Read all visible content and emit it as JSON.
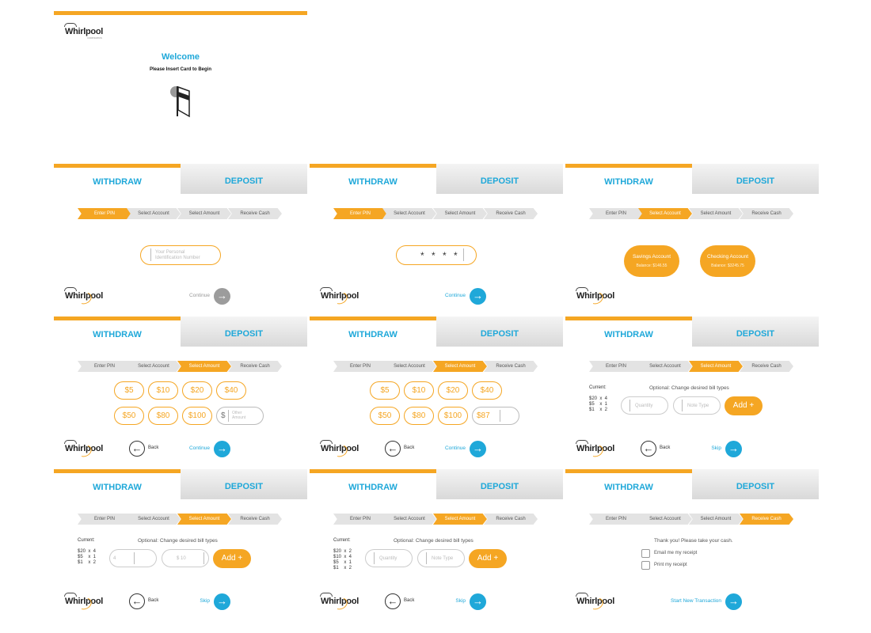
{
  "logo": {
    "text": "Whirlpool",
    "sub": "CORPORATION"
  },
  "tabs": {
    "withdraw": "WITHDRAW",
    "deposit": "DEPOSIT"
  },
  "steps": [
    "Enter PIN",
    "Select Account",
    "Select Amount",
    "Receive Cash"
  ],
  "welcome": {
    "title": "Welcome",
    "subtitle": "Please Insert Card to Begin"
  },
  "pin": {
    "placeholder_line1": "Your Personal",
    "placeholder_line2": "Identification Number",
    "masked": "* * * *"
  },
  "accounts": [
    {
      "name": "Savings Account",
      "balance": "Balance: $146.55"
    },
    {
      "name": "Checking Account",
      "balance": "Balance: $3245.75"
    }
  ],
  "amounts": [
    "$5",
    "$10",
    "$20",
    "$40",
    "$50",
    "$80",
    "$100"
  ],
  "other_amount": {
    "symbol": "$",
    "label_line1": "Other",
    "label_line2": "Amount",
    "entered": "$87"
  },
  "bills": {
    "current_label": "Current:",
    "optional_label": "Optional: Change desired bill types",
    "set_a": [
      "$20  x  4",
      "$5    x  1",
      "$1    x  2"
    ],
    "set_b": [
      "$20  x  2",
      "$10  x  4",
      "$5    x  1",
      "$1    x  2"
    ],
    "quantity_placeholder": "Quantity",
    "note_placeholder": "Note Type",
    "quantity_value": "4",
    "note_value": "$ 10",
    "add": "Add +"
  },
  "nav": {
    "back": "Back",
    "continue": "Continue",
    "skip": "Skip",
    "start_new": "Start New Transaction"
  },
  "receipt": {
    "thanks": "Thank you! Please take your cash.",
    "email": "Email me my receipt",
    "print": "Print my receipt"
  },
  "colors": {
    "accent": "#f5a623",
    "blue": "#1fa8d9"
  }
}
